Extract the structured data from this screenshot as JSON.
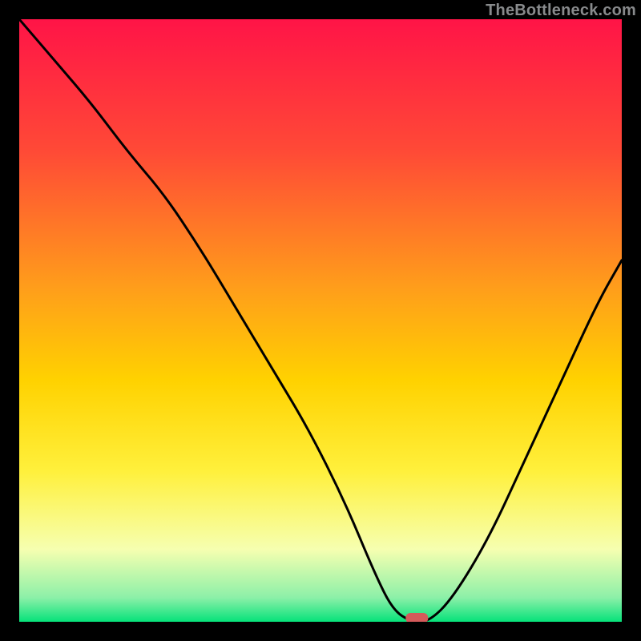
{
  "attribution": "TheBottleneck.com",
  "chart_data": {
    "type": "line",
    "title": "",
    "xlabel": "",
    "ylabel": "",
    "xlim": [
      0,
      100
    ],
    "ylim": [
      0,
      100
    ],
    "x": [
      0,
      6,
      12,
      18,
      24,
      30,
      36,
      42,
      48,
      54,
      59,
      62,
      65,
      68,
      72,
      78,
      84,
      90,
      96,
      100
    ],
    "values": [
      100,
      93,
      86,
      78,
      71,
      62,
      52,
      42,
      32,
      20,
      8,
      2,
      0,
      0,
      4,
      14,
      27,
      40,
      53,
      60
    ],
    "marker": {
      "x": 66,
      "y": 0.6
    },
    "gradient_bands": [
      {
        "pos": 0.0,
        "color": "#ff1447"
      },
      {
        "pos": 0.22,
        "color": "#ff4a36"
      },
      {
        "pos": 0.45,
        "color": "#ff9f1a"
      },
      {
        "pos": 0.6,
        "color": "#ffd200"
      },
      {
        "pos": 0.75,
        "color": "#fff03c"
      },
      {
        "pos": 0.88,
        "color": "#f6ffb0"
      },
      {
        "pos": 0.96,
        "color": "#8cf0a8"
      },
      {
        "pos": 1.0,
        "color": "#06e27a"
      }
    ]
  }
}
